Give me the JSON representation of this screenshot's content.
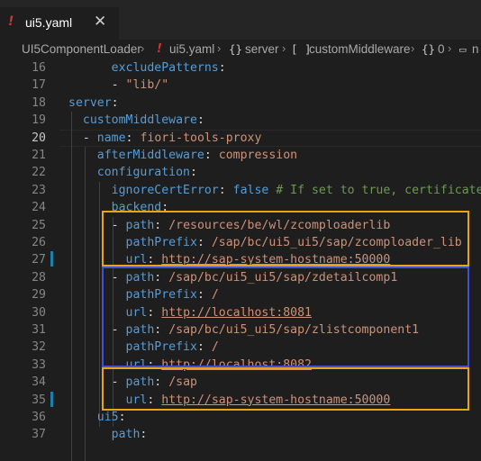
{
  "tab": {
    "icon": "!",
    "label": "ui5.yaml",
    "close": "✕"
  },
  "breadcrumb": {
    "root": "UI5ComponentLoader",
    "file_icon": "!",
    "file": "ui5.yaml",
    "node1_icon": "{}",
    "node1": "server",
    "node2_icon": "[ ]",
    "node2": "customMiddleware",
    "node3_icon": "{}",
    "node3": "0",
    "node4_icon": "▭",
    "node4": "n",
    "separator": "›"
  },
  "editor": {
    "active_line": "20",
    "lines": [
      {
        "n": "16",
        "indent": "      ",
        "parts": [
          {
            "t": "excludePatterns",
            "c": "k"
          },
          {
            "t": ":",
            "c": "p"
          }
        ]
      },
      {
        "n": "17",
        "indent": "      ",
        "parts": [
          {
            "t": "- ",
            "c": "p"
          },
          {
            "t": "\"lib/\"",
            "c": "s"
          }
        ]
      },
      {
        "n": "18",
        "indent": "",
        "parts": [
          {
            "t": "server",
            "c": "k"
          },
          {
            "t": ":",
            "c": "p"
          }
        ]
      },
      {
        "n": "19",
        "indent": "  ",
        "parts": [
          {
            "t": "customMiddleware",
            "c": "k"
          },
          {
            "t": ":",
            "c": "p"
          }
        ]
      },
      {
        "n": "20",
        "indent": "  ",
        "parts": [
          {
            "t": "- ",
            "c": "p"
          },
          {
            "t": "name",
            "c": "k"
          },
          {
            "t": ": ",
            "c": "p"
          },
          {
            "t": "fiori-tools-proxy",
            "c": "s"
          }
        ]
      },
      {
        "n": "21",
        "indent": "    ",
        "parts": [
          {
            "t": "afterMiddleware",
            "c": "k"
          },
          {
            "t": ": ",
            "c": "p"
          },
          {
            "t": "compression",
            "c": "s"
          }
        ]
      },
      {
        "n": "22",
        "indent": "    ",
        "parts": [
          {
            "t": "configuration",
            "c": "k"
          },
          {
            "t": ":",
            "c": "p"
          }
        ]
      },
      {
        "n": "23",
        "indent": "      ",
        "parts": [
          {
            "t": "ignoreCertError",
            "c": "k"
          },
          {
            "t": ": ",
            "c": "p"
          },
          {
            "t": "false",
            "c": "k"
          },
          {
            "t": " # If set to true, certificate e",
            "c": "c"
          }
        ]
      },
      {
        "n": "24",
        "indent": "      ",
        "parts": [
          {
            "t": "backend",
            "c": "k"
          },
          {
            "t": ":",
            "c": "p"
          }
        ]
      },
      {
        "n": "25",
        "indent": "      ",
        "parts": [
          {
            "t": "- ",
            "c": "p"
          },
          {
            "t": "path",
            "c": "k"
          },
          {
            "t": ": ",
            "c": "p"
          },
          {
            "t": "/resources/be/wl/zcomploaderlib",
            "c": "s"
          }
        ]
      },
      {
        "n": "26",
        "indent": "        ",
        "parts": [
          {
            "t": "pathPrefix",
            "c": "k"
          },
          {
            "t": ": ",
            "c": "p"
          },
          {
            "t": "/sap/bc/ui5_ui5/sap/zcomploader_lib",
            "c": "s"
          }
        ]
      },
      {
        "n": "27",
        "indent": "        ",
        "parts": [
          {
            "t": "url",
            "c": "k"
          },
          {
            "t": ": ",
            "c": "p"
          },
          {
            "t": "http://sap-system-hostname:50000",
            "c": "s u"
          }
        ]
      },
      {
        "n": "28",
        "indent": "      ",
        "parts": [
          {
            "t": "- ",
            "c": "p"
          },
          {
            "t": "path",
            "c": "k"
          },
          {
            "t": ": ",
            "c": "p"
          },
          {
            "t": "/sap/bc/ui5_ui5/sap/zdetailcomp1",
            "c": "s"
          }
        ]
      },
      {
        "n": "29",
        "indent": "        ",
        "parts": [
          {
            "t": "pathPrefix",
            "c": "k"
          },
          {
            "t": ": ",
            "c": "p"
          },
          {
            "t": "/",
            "c": "s"
          }
        ]
      },
      {
        "n": "30",
        "indent": "        ",
        "parts": [
          {
            "t": "url",
            "c": "k"
          },
          {
            "t": ": ",
            "c": "p"
          },
          {
            "t": "http://localhost:8081",
            "c": "s u"
          }
        ]
      },
      {
        "n": "31",
        "indent": "      ",
        "parts": [
          {
            "t": "- ",
            "c": "p"
          },
          {
            "t": "path",
            "c": "k"
          },
          {
            "t": ": ",
            "c": "p"
          },
          {
            "t": "/sap/bc/ui5_ui5/sap/zlistcomponent1",
            "c": "s"
          }
        ]
      },
      {
        "n": "32",
        "indent": "        ",
        "parts": [
          {
            "t": "pathPrefix",
            "c": "k"
          },
          {
            "t": ": ",
            "c": "p"
          },
          {
            "t": "/",
            "c": "s"
          }
        ]
      },
      {
        "n": "33",
        "indent": "        ",
        "parts": [
          {
            "t": "url",
            "c": "k"
          },
          {
            "t": ": ",
            "c": "p"
          },
          {
            "t": "http://localhost:8082",
            "c": "s u"
          }
        ]
      },
      {
        "n": "34",
        "indent": "      ",
        "parts": [
          {
            "t": "- ",
            "c": "p"
          },
          {
            "t": "path",
            "c": "k"
          },
          {
            "t": ": ",
            "c": "p"
          },
          {
            "t": "/sap",
            "c": "s"
          }
        ]
      },
      {
        "n": "35",
        "indent": "        ",
        "parts": [
          {
            "t": "url",
            "c": "k"
          },
          {
            "t": ": ",
            "c": "p"
          },
          {
            "t": "http://sap-system-hostname:50000",
            "c": "s u"
          }
        ]
      },
      {
        "n": "36",
        "indent": "    ",
        "parts": [
          {
            "t": "ui5",
            "c": "k"
          },
          {
            "t": ":",
            "c": "p"
          }
        ]
      },
      {
        "n": "37",
        "indent": "      ",
        "parts": [
          {
            "t": "path",
            "c": "k"
          },
          {
            "t": ":",
            "c": "p"
          }
        ]
      }
    ]
  },
  "highlights": {
    "orange": "#e8a317",
    "blue": "#3f51d8"
  }
}
